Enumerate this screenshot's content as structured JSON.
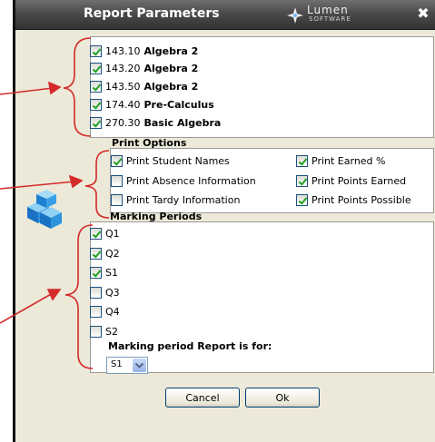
{
  "dialog": {
    "title": "Report Parameters",
    "logo_word": "Lumen",
    "logo_sub": "SOFTWARE",
    "close_glyph": "✖"
  },
  "courses": [
    {
      "code": "143.10",
      "name": "Algebra 2",
      "checked": true
    },
    {
      "code": "143.20",
      "name": "Algebra 2",
      "checked": true
    },
    {
      "code": "143.50",
      "name": "Algebra 2",
      "checked": true
    },
    {
      "code": "174.40",
      "name": "Pre-Calculus",
      "checked": true
    },
    {
      "code": "270.30",
      "name": "Basic Algebra",
      "checked": true
    }
  ],
  "print_options": {
    "title": "Print Options",
    "items": [
      {
        "label": "Print Student Names",
        "checked": true
      },
      {
        "label": "Print Earned %",
        "checked": true
      },
      {
        "label": "Print Absence Information",
        "checked": false
      },
      {
        "label": "Print Points Earned",
        "checked": true
      },
      {
        "label": "Print Tardy Information",
        "checked": false
      },
      {
        "label": "Print Points Possible",
        "checked": true
      }
    ]
  },
  "marking_periods": {
    "title": "Marking Periods",
    "items": [
      {
        "label": "Q1",
        "checked": true
      },
      {
        "label": "Q2",
        "checked": true
      },
      {
        "label": "S1",
        "checked": true
      },
      {
        "label": "Q3",
        "checked": false
      },
      {
        "label": "Q4",
        "checked": false
      },
      {
        "label": "S2",
        "checked": false
      }
    ],
    "report_for_label": "Marking period Report is for:",
    "report_for_value": "S1"
  },
  "buttons": {
    "cancel": "Cancel",
    "ok": "Ok"
  },
  "colors": {
    "annotation": "#d42a2a",
    "titlebar": "#4b4b4b",
    "check": "#21a121",
    "dialog_bg": "#ece9d8"
  },
  "icons": [
    "cubes-icon",
    "chevron-down-icon",
    "close-icon",
    "lumen-logo-icon"
  ]
}
